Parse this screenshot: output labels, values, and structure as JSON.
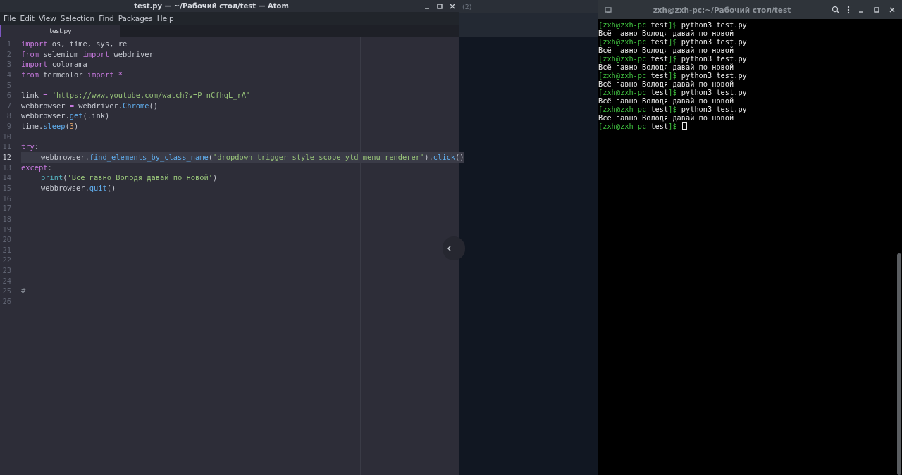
{
  "editor_window": {
    "title": "test.py — ~/Рабочий стол/test — Atom",
    "menu": [
      {
        "label": "File"
      },
      {
        "label": "Edit"
      },
      {
        "label": "View"
      },
      {
        "label": "Selection"
      },
      {
        "label": "Find"
      },
      {
        "label": "Packages"
      },
      {
        "label": "Help"
      }
    ],
    "tabs": [
      {
        "label": "test.py",
        "selected": true
      }
    ],
    "lines": [
      {
        "number": "1",
        "current": false,
        "indented": false,
        "tokens": [
          {
            "kind": "keyword",
            "text": "import"
          },
          {
            "kind": "plain",
            "text": " os, time, sys, re"
          }
        ]
      },
      {
        "number": "2",
        "current": false,
        "indented": false,
        "tokens": [
          {
            "kind": "keyword",
            "text": "from"
          },
          {
            "kind": "plain",
            "text": " selenium "
          },
          {
            "kind": "keyword",
            "text": "import"
          },
          {
            "kind": "plain",
            "text": " webdriver"
          }
        ]
      },
      {
        "number": "3",
        "current": false,
        "indented": false,
        "tokens": [
          {
            "kind": "keyword",
            "text": "import"
          },
          {
            "kind": "plain",
            "text": " colorama"
          }
        ]
      },
      {
        "number": "4",
        "current": false,
        "indented": false,
        "tokens": [
          {
            "kind": "keyword",
            "text": "from"
          },
          {
            "kind": "plain",
            "text": " termcolor "
          },
          {
            "kind": "keyword",
            "text": "import"
          },
          {
            "kind": "operator",
            "text": " *"
          }
        ]
      },
      {
        "number": "5"
      },
      {
        "number": "6",
        "current": false,
        "indented": false,
        "tokens": [
          {
            "kind": "plain",
            "text": "link "
          },
          {
            "kind": "operator",
            "text": "="
          },
          {
            "kind": "string",
            "text": " 'https://www.youtube.com/watch?v=P-nCfhgL_rA'"
          }
        ]
      },
      {
        "number": "7",
        "current": false,
        "indented": false,
        "tokens": [
          {
            "kind": "plain",
            "text": "webbrowser "
          },
          {
            "kind": "operator",
            "text": "="
          },
          {
            "kind": "plain",
            "text": " webdriver."
          },
          {
            "kind": "function",
            "text": "Chrome"
          },
          {
            "kind": "plain",
            "text": "()"
          }
        ]
      },
      {
        "number": "8",
        "current": false,
        "indented": false,
        "tokens": [
          {
            "kind": "plain",
            "text": "webbrowser."
          },
          {
            "kind": "function",
            "text": "get"
          },
          {
            "kind": "plain",
            "text": "(link)"
          }
        ]
      },
      {
        "number": "9",
        "current": false,
        "indented": false,
        "tokens": [
          {
            "kind": "plain",
            "text": "time."
          },
          {
            "kind": "function",
            "text": "sleep"
          },
          {
            "kind": "plain",
            "text": "("
          },
          {
            "kind": "number",
            "text": "3"
          },
          {
            "kind": "plain",
            "text": ")"
          }
        ]
      },
      {
        "number": "10"
      },
      {
        "number": "11",
        "current": false,
        "indented": false,
        "tokens": [
          {
            "kind": "keyword",
            "text": "try"
          },
          {
            "kind": "plain",
            "text": ":"
          }
        ]
      },
      {
        "number": "12",
        "current": true,
        "indented": true,
        "tokens": [
          {
            "kind": "plain",
            "text": "webbrowser."
          },
          {
            "kind": "function",
            "text": "find_elements_by_class_name"
          },
          {
            "kind": "plain",
            "text": "("
          },
          {
            "kind": "string",
            "text": "'dropdown-trigger style-scope ytd-menu-renderer'"
          },
          {
            "kind": "plain",
            "text": ")."
          },
          {
            "kind": "function",
            "text": "click"
          },
          {
            "kind": "plain",
            "text": "()"
          }
        ]
      },
      {
        "number": "13",
        "current": false,
        "indented": false,
        "tokens": [
          {
            "kind": "keyword",
            "text": "except"
          },
          {
            "kind": "plain",
            "text": ":"
          }
        ]
      },
      {
        "number": "14",
        "current": false,
        "indented": true,
        "tokens": [
          {
            "kind": "builtin",
            "text": "print"
          },
          {
            "kind": "plain",
            "text": "("
          },
          {
            "kind": "string",
            "text": "'Всё гавно Володя давай по новой'"
          },
          {
            "kind": "plain",
            "text": ")"
          }
        ]
      },
      {
        "number": "15",
        "current": false,
        "indented": true,
        "tokens": [
          {
            "kind": "plain",
            "text": "webbrowser."
          },
          {
            "kind": "function",
            "text": "quit"
          },
          {
            "kind": "plain",
            "text": "()"
          }
        ]
      },
      {
        "number": "16"
      },
      {
        "number": "17"
      },
      {
        "number": "18"
      },
      {
        "number": "19"
      },
      {
        "number": "20"
      },
      {
        "number": "21"
      },
      {
        "number": "22"
      },
      {
        "number": "23"
      },
      {
        "number": "24"
      },
      {
        "number": "25",
        "current": false,
        "indented": false,
        "tokens": [
          {
            "kind": "comment",
            "text": "#"
          }
        ]
      },
      {
        "number": "26"
      }
    ]
  },
  "background_window": {
    "title": "(2)"
  },
  "terminal_window": {
    "title": "zxh@zxh-pc:~/Рабочий стол/test",
    "lines": [
      {
        "cursor": false,
        "tokens": [
          {
            "kind": "prompt",
            "text": "[zxh@zxh-pc"
          },
          {
            "kind": "path",
            "text": " test"
          },
          {
            "kind": "prompt",
            "text": "]$"
          },
          {
            "kind": "output",
            "text": " python3 test.py"
          }
        ]
      },
      {
        "cursor": false,
        "tokens": [
          {
            "kind": "output",
            "text": "Всё гавно Володя давай по новой"
          }
        ]
      },
      {
        "cursor": false,
        "tokens": [
          {
            "kind": "prompt",
            "text": "[zxh@zxh-pc"
          },
          {
            "kind": "path",
            "text": " test"
          },
          {
            "kind": "prompt",
            "text": "]$"
          },
          {
            "kind": "output",
            "text": " python3 test.py"
          }
        ]
      },
      {
        "cursor": false,
        "tokens": [
          {
            "kind": "output",
            "text": "Всё гавно Володя давай по новой"
          }
        ]
      },
      {
        "cursor": false,
        "tokens": [
          {
            "kind": "prompt",
            "text": "[zxh@zxh-pc"
          },
          {
            "kind": "path",
            "text": " test"
          },
          {
            "kind": "prompt",
            "text": "]$"
          },
          {
            "kind": "output",
            "text": " python3 test.py"
          }
        ]
      },
      {
        "cursor": false,
        "tokens": [
          {
            "kind": "output",
            "text": "Всё гавно Володя давай по новой"
          }
        ]
      },
      {
        "cursor": false,
        "tokens": [
          {
            "kind": "prompt",
            "text": "[zxh@zxh-pc"
          },
          {
            "kind": "path",
            "text": " test"
          },
          {
            "kind": "prompt",
            "text": "]$"
          },
          {
            "kind": "output",
            "text": " python3 test.py"
          }
        ]
      },
      {
        "cursor": false,
        "tokens": [
          {
            "kind": "output",
            "text": "Всё гавно Володя давай по новой"
          }
        ]
      },
      {
        "cursor": false,
        "tokens": [
          {
            "kind": "prompt",
            "text": "[zxh@zxh-pc"
          },
          {
            "kind": "path",
            "text": " test"
          },
          {
            "kind": "prompt",
            "text": "]$"
          },
          {
            "kind": "output",
            "text": " python3 test.py"
          }
        ]
      },
      {
        "cursor": false,
        "tokens": [
          {
            "kind": "output",
            "text": "Всё гавно Володя давай по новой"
          }
        ]
      },
      {
        "cursor": false,
        "tokens": [
          {
            "kind": "prompt",
            "text": "[zxh@zxh-pc"
          },
          {
            "kind": "path",
            "text": " test"
          },
          {
            "kind": "prompt",
            "text": "]$"
          },
          {
            "kind": "output",
            "text": " python3 test.py"
          }
        ]
      },
      {
        "cursor": false,
        "tokens": [
          {
            "kind": "output",
            "text": "Всё гавно Володя давай по новой"
          }
        ]
      },
      {
        "cursor": true,
        "tokens": [
          {
            "kind": "prompt",
            "text": "[zxh@zxh-pc"
          },
          {
            "kind": "path",
            "text": " test"
          },
          {
            "kind": "prompt",
            "text": "]$"
          }
        ]
      }
    ]
  }
}
